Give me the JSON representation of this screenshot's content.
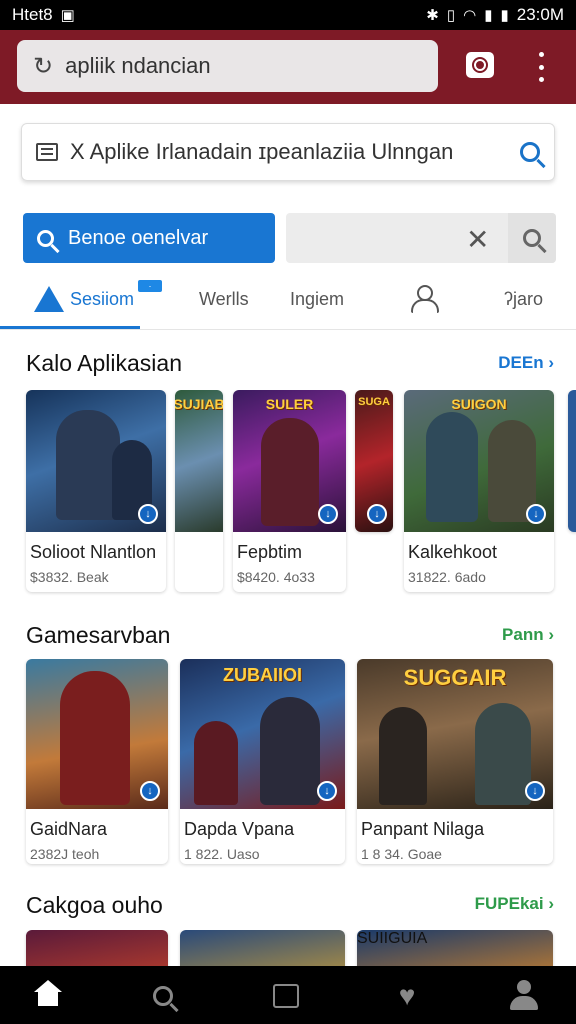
{
  "status_bar": {
    "carrier": "Htet8",
    "time": "23:0M"
  },
  "browser": {
    "url_text": "apliik ndancian"
  },
  "page_search": {
    "text": "X Aplike Irlanadain ɪpeanlaziia Ulnngan"
  },
  "actions": {
    "primary_label": "Benoe oenelvar"
  },
  "tabs": [
    {
      "label": "Sesiiom",
      "active": true,
      "badge": "·"
    },
    {
      "label": "Werlls"
    },
    {
      "label": "Ingiem"
    },
    {
      "label": ""
    },
    {
      "label": "ʔjaro"
    }
  ],
  "sections": [
    {
      "title": "Kalo Aplikasian",
      "link": "DEEn",
      "link_color": "#1976d2",
      "cards": [
        {
          "name": "Solioot Nlantlon",
          "sub": "$3832. Beak",
          "logo": ""
        },
        {
          "name": "",
          "sub": "",
          "logo": "SUJIAB"
        },
        {
          "name": "Fepbtim",
          "sub": "$8420. 4o33",
          "logo": "SULER"
        },
        {
          "name": "",
          "sub": "",
          "logo": "SUGA"
        },
        {
          "name": "Kalkehkoot",
          "sub": "31822. 6ado",
          "logo": "SUIGON"
        }
      ]
    },
    {
      "title": "Gamesarvban",
      "link": "Pann",
      "link_color": "#2e9b4a",
      "cards": [
        {
          "name": "GaidNara",
          "sub": "2382J teoh",
          "logo": ""
        },
        {
          "name": "Dapda Vpana",
          "sub": "1 822. Uaso",
          "logo": "ZUBAIIOI"
        },
        {
          "name": "Panpant Nilaga",
          "sub": "1 8 34. Goae",
          "logo": "SUGGAIR"
        }
      ]
    },
    {
      "title": "Cakgoa ouho",
      "link": "FUPEkai",
      "link_color": "#2e9b4a",
      "cards": [
        {
          "logo": ""
        },
        {
          "logo": ""
        },
        {
          "logo": "SUIIGUIA"
        }
      ]
    }
  ],
  "colors": {
    "appbar": "#7e1a26",
    "accent": "#1976d2"
  },
  "icons": {
    "status": [
      "photo-icon",
      "bluetooth-icon",
      "vibrate-icon",
      "wifi-icon",
      "signal-icon",
      "battery-icon"
    ],
    "bottom_nav": [
      "home-icon",
      "search-icon",
      "store-icon",
      "heart-icon",
      "profile-icon"
    ]
  }
}
